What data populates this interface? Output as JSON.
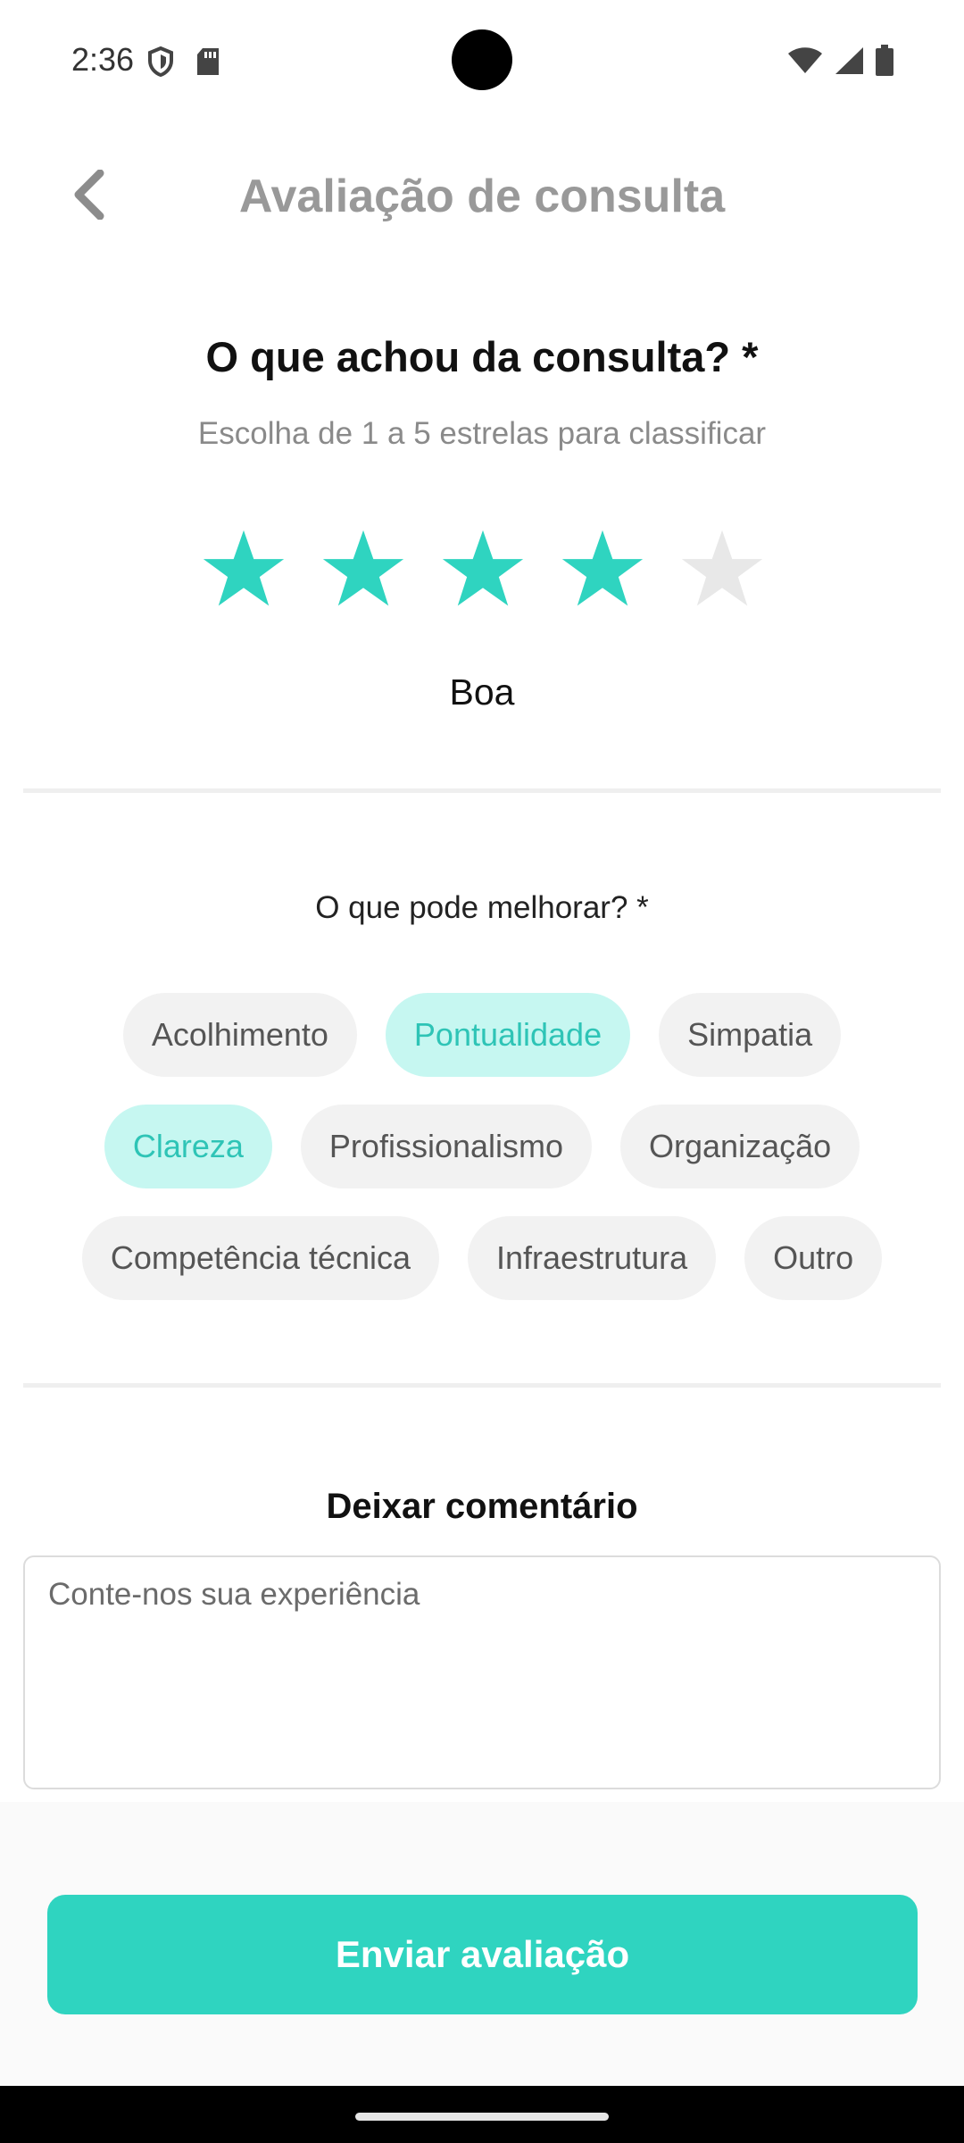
{
  "status_bar": {
    "time": "2:36",
    "left_icons": [
      "shield-icon",
      "sd-card-icon"
    ],
    "right_icons": [
      "wifi-icon",
      "signal-icon",
      "battery-icon"
    ]
  },
  "header": {
    "title": "Avaliação de consulta",
    "back_icon": "chevron-left-icon"
  },
  "rating": {
    "question": "O que achou da consulta? *",
    "hint": "Escolha de 1 a 5 estrelas para classificar",
    "value": 4,
    "max": 5,
    "label": "Boa"
  },
  "improve": {
    "question": "O que pode melhorar? *",
    "chips": [
      {
        "label": "Acolhimento",
        "selected": false
      },
      {
        "label": "Pontualidade",
        "selected": true
      },
      {
        "label": "Simpatia",
        "selected": false
      },
      {
        "label": "Clareza",
        "selected": true
      },
      {
        "label": "Profissionalismo",
        "selected": false
      },
      {
        "label": "Organização",
        "selected": false
      },
      {
        "label": "Competência técnica",
        "selected": false
      },
      {
        "label": "Infraestrutura",
        "selected": false
      },
      {
        "label": "Outro",
        "selected": false
      }
    ]
  },
  "comment": {
    "title": "Deixar comentário",
    "placeholder": "Conte-nos sua experiência",
    "value": ""
  },
  "submit_label": "Enviar avaliação",
  "colors": {
    "accent": "#2fd4c0",
    "star_active": "#2fd4c0",
    "star_inactive": "#e8e8e8",
    "chip_selected_bg": "#c6f7f1",
    "chip_selected_text": "#2ec4b6"
  }
}
